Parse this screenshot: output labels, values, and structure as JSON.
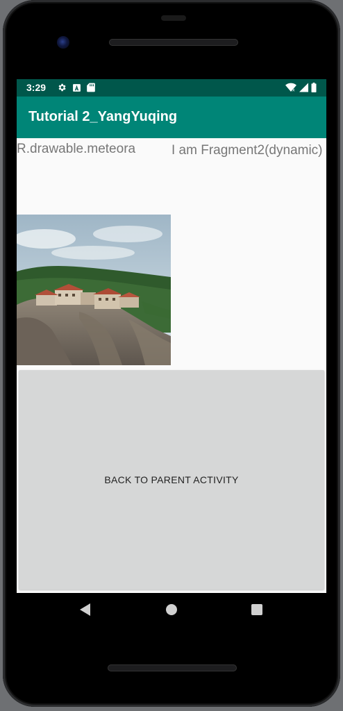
{
  "status_bar": {
    "time": "3:29",
    "left_icons": [
      "gear-icon",
      "a-box-icon",
      "sd-card-icon"
    ],
    "right_icons": [
      "wifi-icon",
      "signal-icon",
      "battery-icon"
    ]
  },
  "app_bar": {
    "title": "Tutorial 2_YangYuqing",
    "color": "#008577",
    "status_color": "#00574b"
  },
  "fragment1": {
    "text": "R.drawable.meteora",
    "image_icon": "meteora-monastery-photo"
  },
  "fragment2": {
    "text": "I am Fragment2(dynamic)"
  },
  "back_button": {
    "label": "BACK TO PARENT ACTIVITY"
  },
  "nav_bar": {
    "icons": [
      "back-triangle-icon",
      "home-circle-icon",
      "recents-square-icon"
    ]
  }
}
